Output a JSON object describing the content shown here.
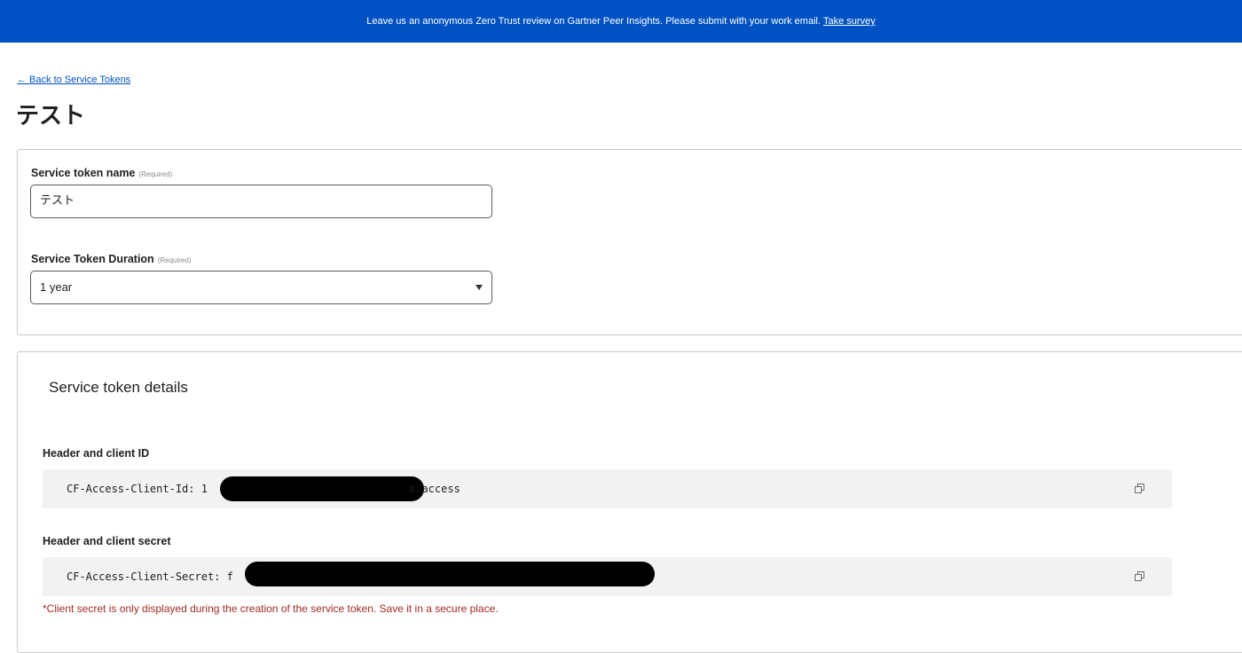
{
  "banner": {
    "text": "Leave us an anonymous Zero Trust review on Gartner Peer Insights. Please submit with your work email.",
    "link": "Take survey",
    "color": "#0051c3"
  },
  "back_link": "← Back to Service Tokens",
  "page_title": "テスト",
  "form": {
    "name_label": "Service token name",
    "name_required": "(Required)",
    "name_value": "テスト",
    "duration_label": "Service Token Duration",
    "duration_required": "(Required)",
    "duration_value": "1 year"
  },
  "details": {
    "title": "Service token details",
    "client_id_label": "Header and client ID",
    "client_id_prefix": "CF-Access-Client-Id: 1",
    "client_id_suffix": "s.access",
    "client_secret_label": "Header and client secret",
    "client_secret_prefix": "CF-Access-Client-Secret: f",
    "warning": "*Client secret is only displayed during the creation of the service token. Save it in a secure place.",
    "warning_color": "#a02c24"
  },
  "icons": {
    "copy": "copy-icon",
    "caret": "chevron-down-icon"
  }
}
